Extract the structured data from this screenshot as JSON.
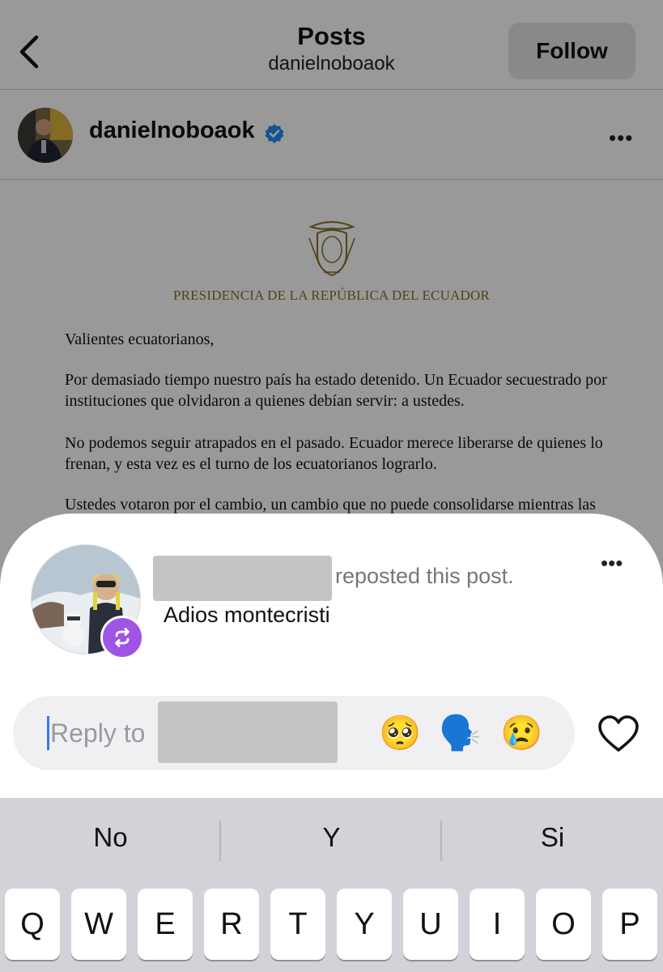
{
  "header": {
    "title": "Posts",
    "subtitle": "danielnoboaok",
    "follow_label": "Follow"
  },
  "post": {
    "username": "danielnoboaok",
    "more": "•••",
    "document": {
      "institution": "PRESIDENCIA DE LA REPÚBLICA DEL ECUADOR",
      "paragraphs": [
        "Valientes ecuatorianos,",
        "Por demasiado tiempo nuestro país ha estado detenido. Un Ecuador secuestrado por instituciones que olvidaron a quienes debían servir: a ustedes.",
        "No podemos seguir atrapados en el pasado. Ecuador merece liberarse de quienes lo frenan, y esta vez es el turno de los ecuatorianos lograrlo.",
        "Ustedes votaron por el cambio, un cambio que no puede consolidarse mientras las"
      ]
    }
  },
  "repost": {
    "reposted_text": "reposted this post.",
    "caption": "Adios montecristi",
    "more": "•••"
  },
  "reply": {
    "placeholder": "Reply to",
    "emojis": [
      "🥺",
      "🗣️",
      "😢"
    ]
  },
  "keyboard": {
    "suggestions": [
      "No",
      "Y",
      "Si"
    ],
    "keys": [
      "Q",
      "W",
      "E",
      "R",
      "T",
      "Y",
      "U",
      "I",
      "O",
      "P"
    ]
  },
  "colors": {
    "verified": "#1d8df0",
    "repost_badge": "#a054e6",
    "cursor": "#3478f6"
  }
}
